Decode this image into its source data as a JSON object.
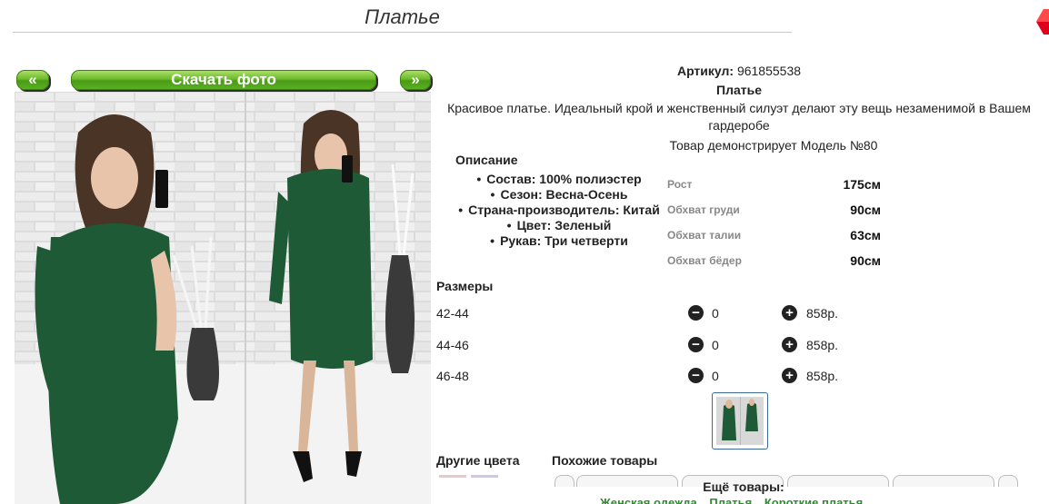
{
  "header": {
    "title": "Платье"
  },
  "gallery": {
    "prev_label": "«",
    "download_label": "Скачать фото",
    "next_label": "»"
  },
  "product": {
    "sku_label": "Артикул:",
    "sku_value": "961855538",
    "name": "Платье",
    "description": "Красивое платье. Идеальный крой и женственный силуэт делают эту вещь незаменимой в Вашем гардеробе",
    "model_text": "Товар демонстрирует Модель №80",
    "description_heading": "Описание",
    "features": [
      "Состав: 100% полиэстер",
      "Сезон: Весна-Осень",
      "Страна-производитель: Китай",
      "Цвет: Зеленый",
      "Рукав: Три четверти"
    ],
    "measurements": [
      {
        "label": "Рост",
        "value": "175см"
      },
      {
        "label": "Обхват груди",
        "value": "90см"
      },
      {
        "label": "Обхват талии",
        "value": "63см"
      },
      {
        "label": "Обхват бёдер",
        "value": "90см"
      }
    ]
  },
  "sizes": {
    "heading": "Размеры",
    "rows": [
      {
        "size": "42-44",
        "qty": "0",
        "price": "858р."
      },
      {
        "size": "44-46",
        "qty": "0",
        "price": "858р."
      },
      {
        "size": "46-48",
        "qty": "0",
        "price": "858р."
      }
    ]
  },
  "related": {
    "other_colors": "Другие цвета",
    "similar": "Похожие товары",
    "more": "Ещё товары:",
    "links": [
      "Женская одежда",
      "Платья",
      "Короткие платья"
    ]
  },
  "colors": {
    "accent_green": "#5bb11f",
    "dress_green": "#1f5a36",
    "link_green": "#2e8b2e"
  }
}
